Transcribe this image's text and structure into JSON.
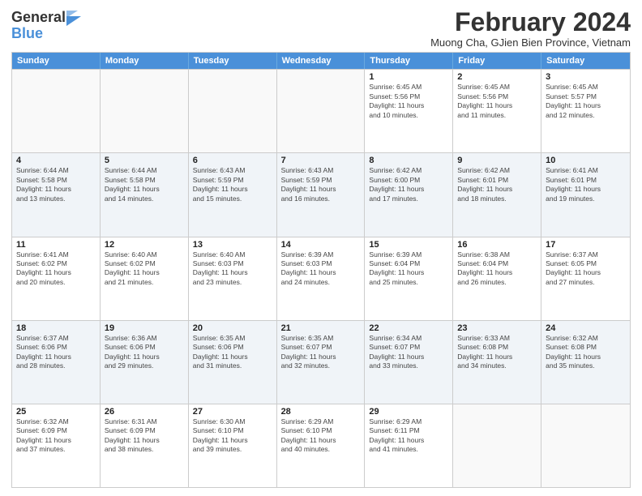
{
  "header": {
    "logo_general": "General",
    "logo_blue": "Blue",
    "month_title": "February 2024",
    "location": "Muong Cha, GJien Bien Province, Vietnam"
  },
  "days": [
    "Sunday",
    "Monday",
    "Tuesday",
    "Wednesday",
    "Thursday",
    "Friday",
    "Saturday"
  ],
  "weeks": [
    [
      {
        "date": "",
        "info": ""
      },
      {
        "date": "",
        "info": ""
      },
      {
        "date": "",
        "info": ""
      },
      {
        "date": "",
        "info": ""
      },
      {
        "date": "1",
        "info": "Sunrise: 6:45 AM\nSunset: 5:56 PM\nDaylight: 11 hours\nand 10 minutes."
      },
      {
        "date": "2",
        "info": "Sunrise: 6:45 AM\nSunset: 5:56 PM\nDaylight: 11 hours\nand 11 minutes."
      },
      {
        "date": "3",
        "info": "Sunrise: 6:45 AM\nSunset: 5:57 PM\nDaylight: 11 hours\nand 12 minutes."
      }
    ],
    [
      {
        "date": "4",
        "info": "Sunrise: 6:44 AM\nSunset: 5:58 PM\nDaylight: 11 hours\nand 13 minutes."
      },
      {
        "date": "5",
        "info": "Sunrise: 6:44 AM\nSunset: 5:58 PM\nDaylight: 11 hours\nand 14 minutes."
      },
      {
        "date": "6",
        "info": "Sunrise: 6:43 AM\nSunset: 5:59 PM\nDaylight: 11 hours\nand 15 minutes."
      },
      {
        "date": "7",
        "info": "Sunrise: 6:43 AM\nSunset: 5:59 PM\nDaylight: 11 hours\nand 16 minutes."
      },
      {
        "date": "8",
        "info": "Sunrise: 6:42 AM\nSunset: 6:00 PM\nDaylight: 11 hours\nand 17 minutes."
      },
      {
        "date": "9",
        "info": "Sunrise: 6:42 AM\nSunset: 6:01 PM\nDaylight: 11 hours\nand 18 minutes."
      },
      {
        "date": "10",
        "info": "Sunrise: 6:41 AM\nSunset: 6:01 PM\nDaylight: 11 hours\nand 19 minutes."
      }
    ],
    [
      {
        "date": "11",
        "info": "Sunrise: 6:41 AM\nSunset: 6:02 PM\nDaylight: 11 hours\nand 20 minutes."
      },
      {
        "date": "12",
        "info": "Sunrise: 6:40 AM\nSunset: 6:02 PM\nDaylight: 11 hours\nand 21 minutes."
      },
      {
        "date": "13",
        "info": "Sunrise: 6:40 AM\nSunset: 6:03 PM\nDaylight: 11 hours\nand 23 minutes."
      },
      {
        "date": "14",
        "info": "Sunrise: 6:39 AM\nSunset: 6:03 PM\nDaylight: 11 hours\nand 24 minutes."
      },
      {
        "date": "15",
        "info": "Sunrise: 6:39 AM\nSunset: 6:04 PM\nDaylight: 11 hours\nand 25 minutes."
      },
      {
        "date": "16",
        "info": "Sunrise: 6:38 AM\nSunset: 6:04 PM\nDaylight: 11 hours\nand 26 minutes."
      },
      {
        "date": "17",
        "info": "Sunrise: 6:37 AM\nSunset: 6:05 PM\nDaylight: 11 hours\nand 27 minutes."
      }
    ],
    [
      {
        "date": "18",
        "info": "Sunrise: 6:37 AM\nSunset: 6:06 PM\nDaylight: 11 hours\nand 28 minutes."
      },
      {
        "date": "19",
        "info": "Sunrise: 6:36 AM\nSunset: 6:06 PM\nDaylight: 11 hours\nand 29 minutes."
      },
      {
        "date": "20",
        "info": "Sunrise: 6:35 AM\nSunset: 6:06 PM\nDaylight: 11 hours\nand 31 minutes."
      },
      {
        "date": "21",
        "info": "Sunrise: 6:35 AM\nSunset: 6:07 PM\nDaylight: 11 hours\nand 32 minutes."
      },
      {
        "date": "22",
        "info": "Sunrise: 6:34 AM\nSunset: 6:07 PM\nDaylight: 11 hours\nand 33 minutes."
      },
      {
        "date": "23",
        "info": "Sunrise: 6:33 AM\nSunset: 6:08 PM\nDaylight: 11 hours\nand 34 minutes."
      },
      {
        "date": "24",
        "info": "Sunrise: 6:32 AM\nSunset: 6:08 PM\nDaylight: 11 hours\nand 35 minutes."
      }
    ],
    [
      {
        "date": "25",
        "info": "Sunrise: 6:32 AM\nSunset: 6:09 PM\nDaylight: 11 hours\nand 37 minutes."
      },
      {
        "date": "26",
        "info": "Sunrise: 6:31 AM\nSunset: 6:09 PM\nDaylight: 11 hours\nand 38 minutes."
      },
      {
        "date": "27",
        "info": "Sunrise: 6:30 AM\nSunset: 6:10 PM\nDaylight: 11 hours\nand 39 minutes."
      },
      {
        "date": "28",
        "info": "Sunrise: 6:29 AM\nSunset: 6:10 PM\nDaylight: 11 hours\nand 40 minutes."
      },
      {
        "date": "29",
        "info": "Sunrise: 6:29 AM\nSunset: 6:11 PM\nDaylight: 11 hours\nand 41 minutes."
      },
      {
        "date": "",
        "info": ""
      },
      {
        "date": "",
        "info": ""
      }
    ]
  ]
}
